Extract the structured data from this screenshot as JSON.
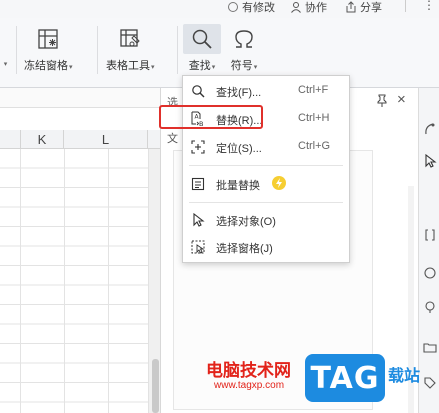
{
  "topbar": {
    "modified": "有修改",
    "collaborate": "协作",
    "share": "分享",
    "more": "⋮"
  },
  "ribbon": {
    "freeze": "冻结窗格",
    "table_tools": "表格工具",
    "find": "查找",
    "symbol": "符号"
  },
  "sheet": {
    "columns": [
      "K",
      "L"
    ]
  },
  "pane": {
    "title": "选",
    "sub": "文"
  },
  "menu": {
    "items": [
      {
        "label": "查找(F)...",
        "shortcut": "Ctrl+F"
      },
      {
        "label": "替换(R)...",
        "shortcut": "Ctrl+H"
      },
      {
        "label": "定位(S)...",
        "shortcut": "Ctrl+G"
      },
      {
        "label": "批量替换"
      },
      {
        "label": "选择对象(O)"
      },
      {
        "label": "选择窗格(J)"
      }
    ],
    "highlight_color": "#e0302b",
    "badge_color": "#f6ce32"
  },
  "watermark": {
    "cn_text": "电脑技术网",
    "url": "www.tagxp.com",
    "logo": "TAG",
    "suffix": "载站"
  }
}
